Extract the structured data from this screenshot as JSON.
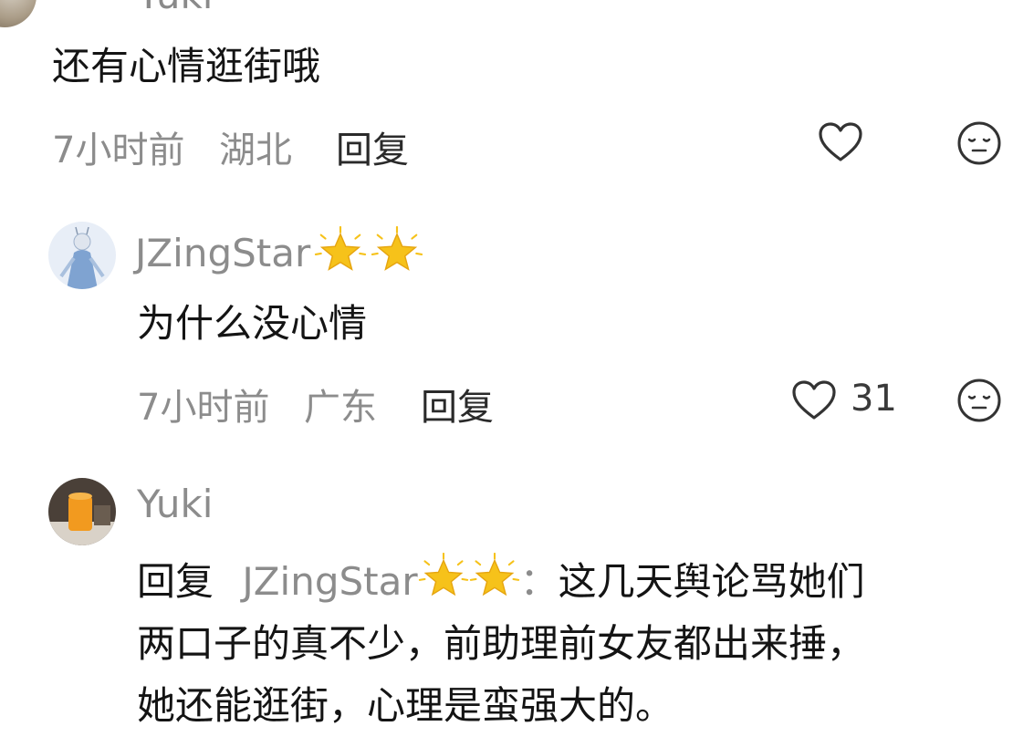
{
  "top_comment": {
    "username_fragment": "Yuki",
    "text": "还有心情逛街哦",
    "time": "7小时前",
    "location": "湖北",
    "reply_label": "回复"
  },
  "reply1": {
    "username": "JZingStar",
    "text": "为什么没心情",
    "time": "7小时前",
    "location": "广东",
    "reply_label": "回复",
    "like_count": "31"
  },
  "reply2": {
    "username": "Yuki",
    "reply_prefix": "回复",
    "mention": "JZingStar",
    "colon": "：",
    "line1": "这几天舆论骂她们",
    "line2": "两口子的真不少，前助理前女友都出来捶，",
    "line3": "她还能逛街，心理是蛮强大的。"
  },
  "icons": {
    "like": "heart-outline-icon",
    "emoji": "neutral-face-icon",
    "star": "glowing-star-emoji"
  },
  "colors": {
    "meta": "#8c8c8c",
    "text": "#141414",
    "star": "#f6c21a"
  }
}
